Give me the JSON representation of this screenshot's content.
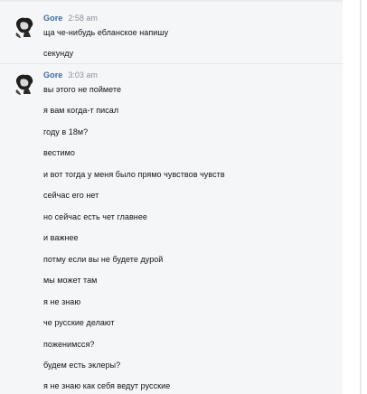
{
  "messages": [
    {
      "author": "Gore",
      "time": "2:58 am",
      "lines": [
        "ща че-нибудь ебланское напишу",
        "секунду"
      ]
    },
    {
      "author": "Gore",
      "time": "3:03 am",
      "lines": [
        "вы этого не поймете",
        "я вам когда-т писал",
        "году в 18м?",
        "вестимо",
        "и вот тогда у меня было прямо чувствов чувств",
        "сейчас его нет",
        "но сейчас есть чет главнее",
        "и важнее",
        "потму если вы не будете дурой",
        "мы может там",
        "я не знаю",
        "че русские делают",
        "поженимсся?",
        "будем есть эклеры?",
        "я не знаю как себя ведут русские"
      ]
    }
  ]
}
